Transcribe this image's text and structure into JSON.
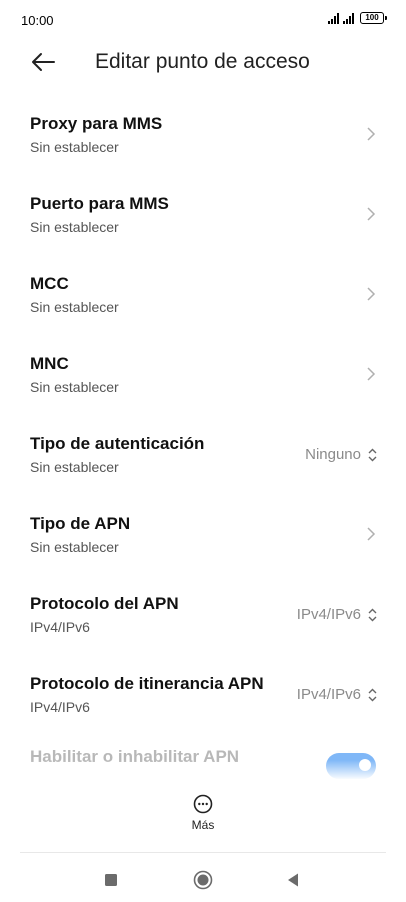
{
  "status_bar": {
    "time": "10:00",
    "battery": "100"
  },
  "header": {
    "title": "Editar punto de acceso"
  },
  "rows": [
    {
      "title": "Proxy para MMS",
      "subtitle": "Sin establecer"
    },
    {
      "title": "Puerto para MMS",
      "subtitle": "Sin establecer"
    },
    {
      "title": "MCC",
      "subtitle": "Sin establecer"
    },
    {
      "title": "MNC",
      "subtitle": "Sin establecer"
    },
    {
      "title": "Tipo de autenticación",
      "subtitle": "Sin establecer",
      "value": "Ninguno"
    },
    {
      "title": "Tipo de APN",
      "subtitle": "Sin establecer"
    },
    {
      "title": "Protocolo del APN",
      "subtitle": "IPv4/IPv6",
      "value": "IPv4/IPv6"
    },
    {
      "title": "Protocolo de itinerancia APN",
      "subtitle": "IPv4/IPv6",
      "value": "IPv4/IPv6"
    }
  ],
  "toggle_row": {
    "title": "Habilitar o inhabilitar APN",
    "enabled": true
  },
  "footer": {
    "more_label": "Más"
  },
  "colors": {
    "toggle_on": "#7fb7f7",
    "secondary_text": "#555555",
    "value_text": "#8a8a8a"
  },
  "icons": {
    "back": "arrow-left-icon",
    "chevron": "chevron-right-icon",
    "selector": "chevron-up-down-icon",
    "more": "ellipsis-circle-icon"
  }
}
